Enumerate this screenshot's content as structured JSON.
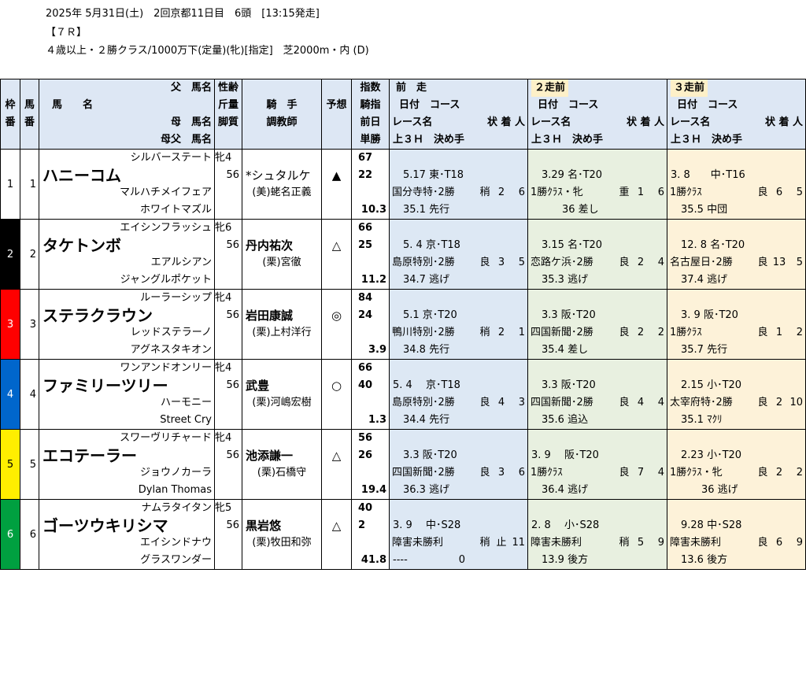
{
  "race": {
    "line1": "2025年 5月31日(土)　2回京都11日目　6頭　[13:15発走]",
    "line2": "【７Ｒ】",
    "line3": "４歳以上・２勝クラス/1000万下(定量)(牝)[指定]　芝2000m・内 (D)"
  },
  "header": {
    "waku": [
      "枠",
      "番"
    ],
    "uma": [
      "馬",
      "番"
    ],
    "chichi": "父　馬名",
    "bamei": "馬　　名",
    "haha": "母　馬名",
    "hahachichi": "母父　馬名",
    "seirei": "性齢",
    "kinryo": "斤量",
    "kyakushitsu": "脚質",
    "kishu": "騎　手",
    "chokyoshi": "調教師",
    "yoso": "予想",
    "shisu": "指数",
    "kishi": "騎指",
    "zenjitsu": "前日",
    "tansho": "単勝",
    "zenso": "前　走",
    "nisoumae": "２走前",
    "sansoumae": "３走前",
    "hizuke": "日付　コース",
    "race_name": "レース名",
    "jochakunin": "状 着 人",
    "agari": "上３Ｈ　決め手"
  },
  "colors": {
    "header_bg": "#dde7f4",
    "prev1_bg": "#dde8f4",
    "prev2_bg": "#e8f0e0",
    "prev3_bg": "#fdf2d9"
  },
  "horses": [
    {
      "waku": "1",
      "waku_bg": "#ffffff",
      "waku_fg": "#000000",
      "uma": "1",
      "sire": "シルバーステート",
      "name": "ハニーコム",
      "dam": "マルハチメイフェア",
      "damsire": "ホワイトマズル",
      "sexage": "牝4",
      "weight": "56",
      "jockey": "*シュタルケ",
      "jockey_bold": false,
      "trainer": "(美)蛯名正義",
      "mark": "▲",
      "index": "67",
      "jindex": "22",
      "odds": "10.3",
      "p1": {
        "date": "　5.17 東･T18",
        "race": "国分寺特･2勝",
        "cond": "稍",
        "place": "2",
        "pop": "6",
        "last": "　35.1 先行"
      },
      "p2": {
        "date": "　3.29 名･T20",
        "race": "1勝ｸﾗｽ・牝",
        "cond": "重",
        "place": "1",
        "pop": "6",
        "last": "　　　36 差し"
      },
      "p3": {
        "date": "3. 8　　中･T16",
        "race": "1勝ｸﾗｽ",
        "cond": "良",
        "place": "6",
        "pop": "5",
        "last": "　35.5 中団"
      }
    },
    {
      "waku": "2",
      "waku_bg": "#000000",
      "waku_fg": "#ffffff",
      "uma": "2",
      "sire": "エイシンフラッシュ",
      "name": "タケトンボ",
      "dam": "エアルシアン",
      "damsire": "ジャングルポケット",
      "sexage": "牝6",
      "weight": "56",
      "jockey": "丹内祐次",
      "jockey_bold": true,
      "trainer": "(栗)宮徹",
      "mark": "△",
      "index": "66",
      "jindex": "25",
      "odds": "11.2",
      "p1": {
        "date": "　5. 4 京･T18",
        "race": "島原特別･2勝",
        "cond": "良",
        "place": "3",
        "pop": "5",
        "last": "　34.7 逃げ"
      },
      "p2": {
        "date": "　3.15 名･T20",
        "race": "恋路ケ浜･2勝",
        "cond": "良",
        "place": "2",
        "pop": "4",
        "last": "　35.3 逃げ"
      },
      "p3": {
        "date": "　12. 8 名･T20",
        "race": "名古屋日･2勝",
        "cond": "良",
        "place": "13",
        "pop": "5",
        "last": "　37.4 逃げ"
      }
    },
    {
      "waku": "3",
      "waku_bg": "#ff0000",
      "waku_fg": "#ffffff",
      "uma": "3",
      "sire": "ルーラーシップ",
      "name": "ステラクラウン",
      "dam": "レッドステラーノ",
      "damsire": "アグネスタキオン",
      "sexage": "牝4",
      "weight": "56",
      "jockey": "岩田康誠",
      "jockey_bold": true,
      "trainer": "(栗)上村洋行",
      "mark": "◎",
      "index": "84",
      "jindex": "24",
      "odds": "3.9",
      "p1": {
        "date": "　5.1 京･T20",
        "race": "鴨川特別･2勝",
        "cond": "稍",
        "place": "2",
        "pop": "1",
        "last": "　34.8 先行"
      },
      "p2": {
        "date": "　3.3 阪･T20",
        "race": "四国新聞･2勝",
        "cond": "良",
        "place": "2",
        "pop": "2",
        "last": "　35.4 差し"
      },
      "p3": {
        "date": "　3. 9 阪･T20",
        "race": "1勝ｸﾗｽ",
        "cond": "良",
        "place": "1",
        "pop": "2",
        "last": "　35.7 先行"
      }
    },
    {
      "waku": "4",
      "waku_bg": "#0066cc",
      "waku_fg": "#ffffff",
      "uma": "4",
      "sire": "ワンアンドオンリー",
      "name": "ファミリーツリー",
      "dam": "ハーモニー",
      "damsire": "Street Cry",
      "sexage": "牝4",
      "weight": "56",
      "jockey": "武豊",
      "jockey_bold": true,
      "trainer": "(栗)河嶋宏樹",
      "mark": "○",
      "index": "66",
      "jindex": "40",
      "odds": "1.3",
      "p1": {
        "date": "5. 4　 京･T18",
        "race": "島原特別･2勝",
        "cond": "良",
        "place": "4",
        "pop": "3",
        "last": "　34.4 先行"
      },
      "p2": {
        "date": "　3.3 阪･T20",
        "race": "四国新聞･2勝",
        "cond": "良",
        "place": "4",
        "pop": "4",
        "last": "　35.6 追込"
      },
      "p3": {
        "date": "　2.15 小･T20",
        "race": "太宰府特･2勝",
        "cond": "良",
        "place": "2",
        "pop": "10",
        "last": "　35.1 ﾏｸﾘ"
      }
    },
    {
      "waku": "5",
      "waku_bg": "#ffee00",
      "waku_fg": "#000000",
      "uma": "5",
      "sire": "スワーヴリチャード",
      "name": "エコテーラー",
      "dam": "ジョウノカーラ",
      "damsire": "Dylan Thomas",
      "sexage": "牝4",
      "weight": "56",
      "jockey": "池添謙一",
      "jockey_bold": true,
      "trainer": "(栗)石橋守",
      "mark": "△",
      "index": "56",
      "jindex": "26",
      "odds": "19.4",
      "p1": {
        "date": "　3.3 阪･T20",
        "race": "四国新聞･2勝",
        "cond": "良",
        "place": "3",
        "pop": "6",
        "last": "　36.3 逃げ"
      },
      "p2": {
        "date": "3. 9　 阪･T20",
        "race": "1勝ｸﾗｽ",
        "cond": "良",
        "place": "7",
        "pop": "4",
        "last": "　36.4 逃げ"
      },
      "p3": {
        "date": "　2.23 小･T20",
        "race": "1勝ｸﾗｽ・牝",
        "cond": "良",
        "place": "2",
        "pop": "2",
        "last": "　　　36 逃げ"
      }
    },
    {
      "waku": "6",
      "waku_bg": "#00a040",
      "waku_fg": "#ffffff",
      "uma": "6",
      "sire": "ナムラタイタン",
      "name": "ゴーツウキリシマ",
      "dam": "エイシンドナウ",
      "damsire": "グラスワンダー",
      "sexage": "牝5",
      "weight": "56",
      "jockey": "黒岩悠",
      "jockey_bold": true,
      "trainer": "(栗)牧田和弥",
      "mark": "△",
      "index": "40",
      "jindex": "2",
      "odds": "41.8",
      "p1": {
        "date": "3. 9　 中･S28",
        "race": "障害未勝利",
        "cond": "稍",
        "place": "止",
        "pop": "11",
        "last": "----　　　　　0"
      },
      "p2": {
        "date": "2. 8　 小･S28",
        "race": "障害未勝利",
        "cond": "稍",
        "place": "5",
        "pop": "9",
        "last": "　13.9 後方"
      },
      "p3": {
        "date": "　9.28 中･S28",
        "race": "障害未勝利",
        "cond": "良",
        "place": "6",
        "pop": "9",
        "last": "　13.6 後方"
      }
    }
  ]
}
